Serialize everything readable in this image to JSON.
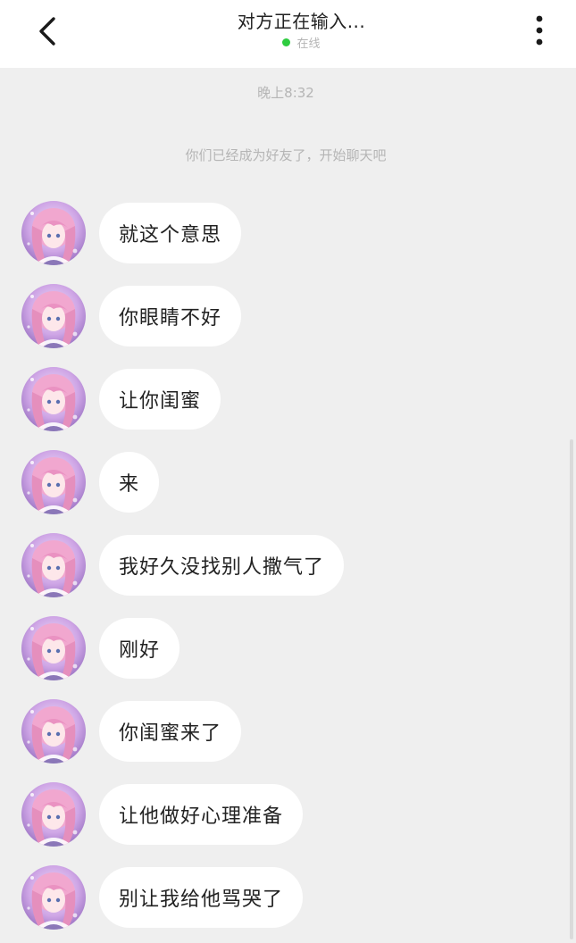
{
  "header": {
    "title": "对方正在输入...",
    "status": "在线"
  },
  "timestamp": "晚上8:32",
  "system_message": "你们已经成为好友了，开始聊天吧",
  "messages": [
    {
      "text": "就这个意思"
    },
    {
      "text": "你眼睛不好"
    },
    {
      "text": "让你闺蜜"
    },
    {
      "text": "来"
    },
    {
      "text": "我好久没找别人撒气了"
    },
    {
      "text": "刚好"
    },
    {
      "text": "你闺蜜来了"
    },
    {
      "text": "让他做好心理准备"
    },
    {
      "text": "别让我给他骂哭了"
    }
  ],
  "colors": {
    "background": "#efefef",
    "header_background": "#ffffff",
    "bubble": "#ffffff",
    "online_dot": "#2ecc40",
    "meta_text": "#b5b5b5"
  },
  "icons": {
    "back": "chevron-left-icon",
    "more": "more-vertical-icon",
    "avatar": "anime-girl-avatar"
  }
}
